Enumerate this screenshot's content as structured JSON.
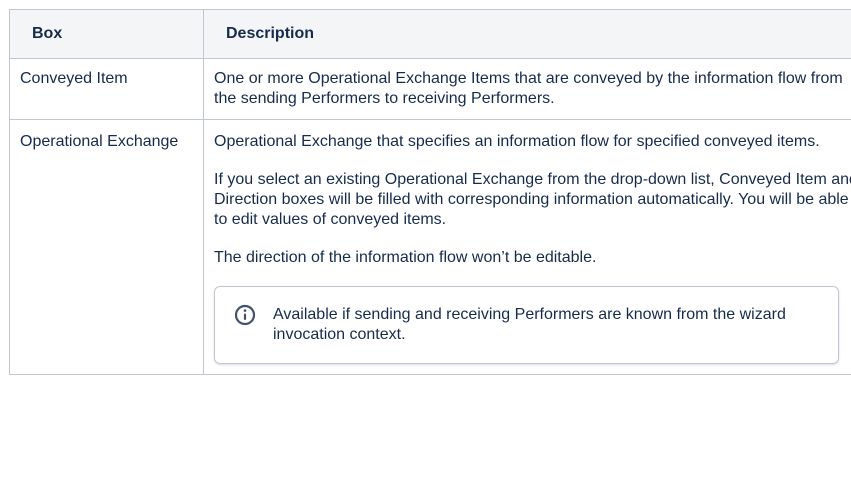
{
  "table": {
    "headers": [
      "Box",
      "Description"
    ],
    "rows": [
      {
        "box": "Conveyed Item",
        "description": [
          "One or more Operational Exchange Items that are conveyed by the information flow from the sending Performers to receiving Performers."
        ]
      },
      {
        "box": "Operational Exchange",
        "description": [
          "Operational Exchange that specifies an information flow for specified conveyed items.",
          "If you select an existing Operational Exchange from the drop-down list, Conveyed Item and Direction boxes will be filled with corresponding information automatically. You will be able to edit values of conveyed items.",
          "The direction of the information flow won’t be editable."
        ],
        "info_panel": {
          "icon": "info-icon",
          "text": "Available if sending and receiving Performers are known from the wizard invocation context."
        }
      }
    ]
  },
  "colors": {
    "header_bg": "#f4f5f7",
    "border": "#c1c7d0",
    "text": "#172b4d",
    "icon": "#42526e"
  }
}
